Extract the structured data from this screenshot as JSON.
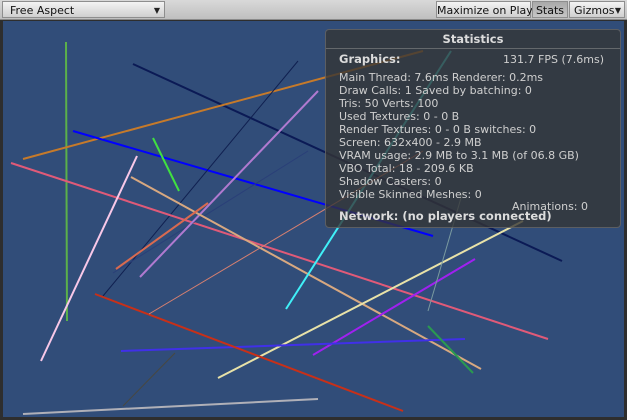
{
  "toolbar": {
    "aspect_label": "Free Aspect",
    "maximize_label": "Maximize on Play",
    "stats_label": "Stats",
    "gizmos_label": "Gizmos"
  },
  "stats_panel": {
    "title": "Statistics",
    "graphics_label": "Graphics:",
    "fps": "131.7 FPS (7.6ms)",
    "lines": [
      "Main Thread: 7.6ms  Renderer: 0.2ms",
      "Draw Calls: 1  Saved by batching: 0",
      "Tris: 50   Verts: 100",
      "Used Textures: 0 - 0 B",
      "Render Textures: 0 - 0 B  switches: 0",
      "Screen: 632x400 - 2.9 MB",
      "VRAM usage: 2.9 MB to 3.1 MB (of 06.8 GB)",
      "VBO Total: 18 - 209.6 KB",
      "Shadow Casters: 0",
      "Visible Skinned Meshes: 0"
    ],
    "animations": "Animations: 0",
    "network": "Network: (no players connected)"
  },
  "colors": {
    "viewport_background": "#314d79",
    "panel_background": "#343434",
    "lines": [
      "#5bb04a",
      "#0b1a55",
      "#c67a2a",
      "#0000ff",
      "#102050",
      "#e05a78",
      "#f8c8e8",
      "#2a3f78",
      "#b07ad0",
      "#d8a880",
      "#d86a50",
      "#e8e2a8",
      "#40f0f8",
      "#40e040",
      "#a020f0",
      "#4030e8",
      "#c83018",
      "#d88070",
      "#b0b0b8",
      "#484840",
      "#7a9aa0",
      "#2a9a50"
    ]
  }
}
